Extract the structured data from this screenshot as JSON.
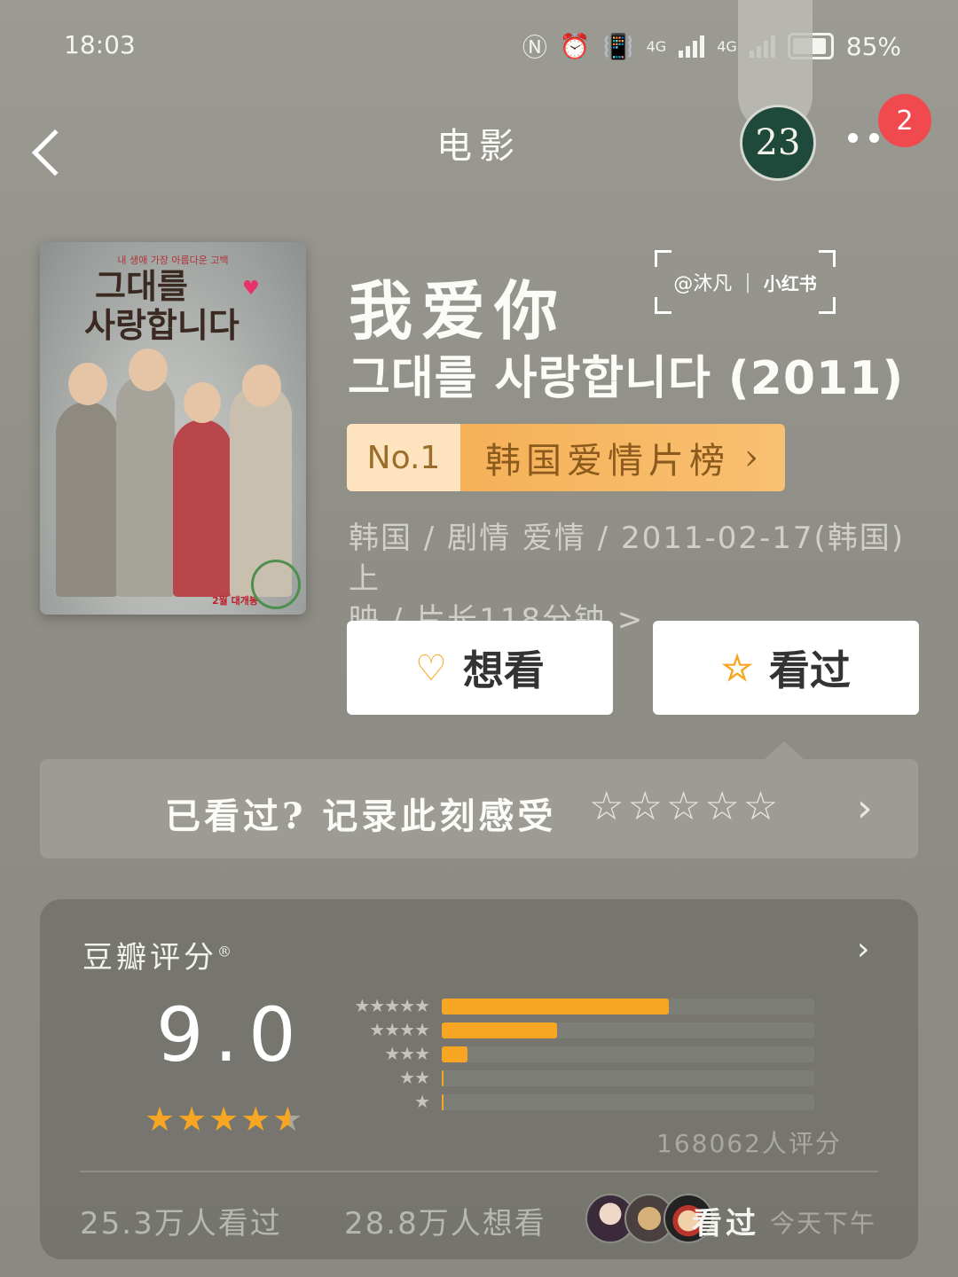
{
  "status_bar": {
    "time": "18:03",
    "network_1": "4G",
    "network_2": "4G",
    "battery": "85%"
  },
  "header": {
    "title": "电影",
    "tag_badge": "23",
    "notification_count": "2"
  },
  "poster": {
    "kicker": "내 생애 가장 아름다운 고백",
    "title_line1": "그대를",
    "title_line2": "사랑합니다",
    "release_note": "2월 대개봉"
  },
  "watermark": {
    "author": "@沐凡",
    "brand": "小红书"
  },
  "movie": {
    "title_cn": "我爱你",
    "title_original": "그대를 사랑합니다 (2011)",
    "rank_no": "No.1",
    "rank_list": "韩国爱情片榜",
    "meta_line1": "韩国 / 剧情 爱情 / 2011-02-17(韩国)上",
    "meta_line2": "映 / 片长118分钟 >"
  },
  "actions": {
    "want_label": "想看",
    "seen_label": "看过"
  },
  "record": {
    "prompt": "已看过? 记录此刻感受",
    "stars": "☆☆☆☆☆"
  },
  "rating": {
    "label": "豆瓣评分",
    "registered": "®",
    "score": "9.0",
    "stars_value": 4.5,
    "count_text": "168062人评分",
    "distribution": [
      {
        "stars": "★★★★★",
        "fraction": 0.61
      },
      {
        "stars": "★★★★",
        "fraction": 0.31
      },
      {
        "stars": "★★★",
        "fraction": 0.07
      },
      {
        "stars": "★★",
        "fraction": 0.005
      },
      {
        "stars": "★",
        "fraction": 0.004
      }
    ]
  },
  "social": {
    "watched_count": "25.3万人看过",
    "wish_count": "28.8万人想看",
    "friend_status": "看过",
    "friend_time": "今天下午"
  },
  "colors": {
    "accent": "#f6a623",
    "badge_red": "#f04a4e",
    "tag_green": "#1f4a3b"
  }
}
